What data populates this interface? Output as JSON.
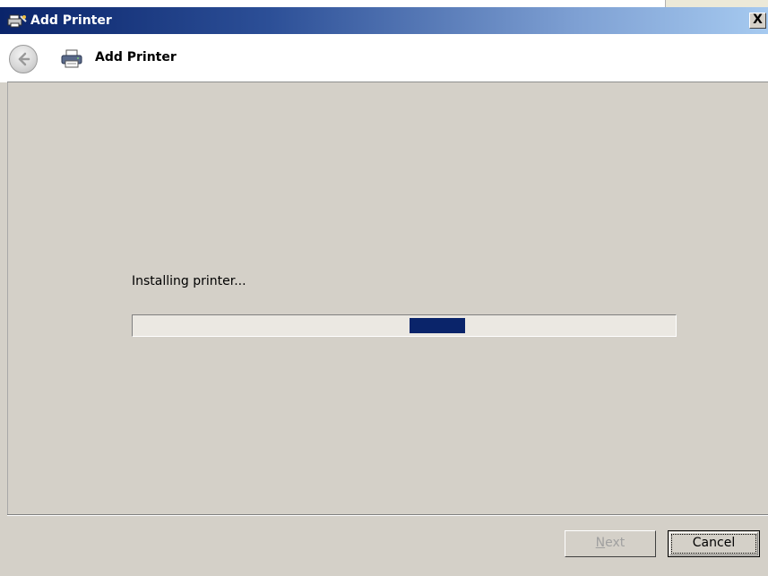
{
  "window": {
    "title": "Add Printer",
    "close_glyph": "X",
    "title_icon": "printer-wizard-icon"
  },
  "header": {
    "back_icon": "back-arrow-icon",
    "icon": "printer-icon",
    "title": "Add Printer"
  },
  "content": {
    "status_text": "Installing printer...",
    "progress": {
      "mode": "indeterminate",
      "color": "#0a246a"
    }
  },
  "footer": {
    "next_label": "Next",
    "next_enabled": false,
    "cancel_label": "Cancel"
  },
  "colors": {
    "titlebar_start": "#0a246a",
    "titlebar_end": "#a6caf0",
    "dialog_bg": "#d4d0c8",
    "header_bg": "#ffffff"
  }
}
